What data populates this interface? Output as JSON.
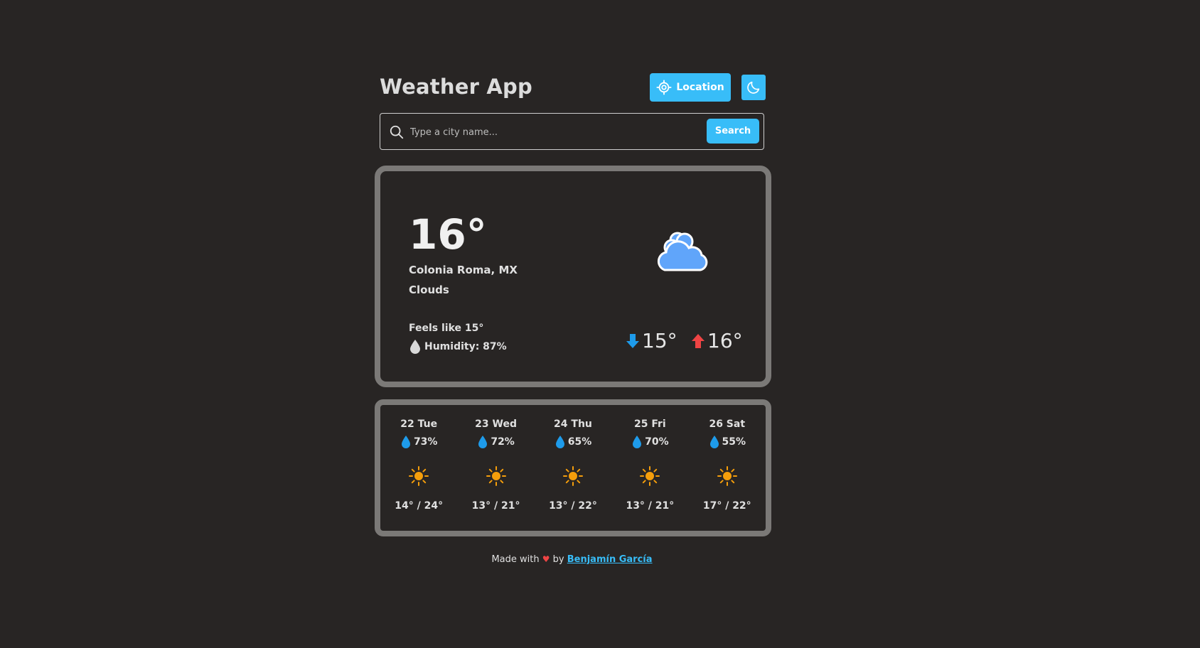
{
  "header": {
    "title": "Weather App",
    "location_button": "Location",
    "location_icon": "crosshair-icon",
    "theme_icon": "moon-icon"
  },
  "search": {
    "placeholder": "Type a city name...",
    "button_label": "Search",
    "icon": "search-icon"
  },
  "current": {
    "temp": "16°",
    "city": "Colonia Roma, MX",
    "description": "Clouds",
    "icon": "cloud-icon",
    "feels_like": "Feels like 15°",
    "humidity": "Humidity: 87%",
    "min_temp": "15°",
    "max_temp": "16°",
    "colors": {
      "min_arrow": "#1e9bea",
      "max_arrow": "#ef4444",
      "cloud": "#60a5fa"
    }
  },
  "forecast": [
    {
      "day": "22 Tue",
      "humidity": "73%",
      "icon": "sun-icon",
      "range": "14° / 24°"
    },
    {
      "day": "23 Wed",
      "humidity": "72%",
      "icon": "sun-icon",
      "range": "13° / 21°"
    },
    {
      "day": "24 Thu",
      "humidity": "65%",
      "icon": "sun-icon",
      "range": "13° / 22°"
    },
    {
      "day": "25 Fri",
      "humidity": "70%",
      "icon": "sun-icon",
      "range": "13° / 21°"
    },
    {
      "day": "26 Sat",
      "humidity": "55%",
      "icon": "sun-icon",
      "range": "17° / 22°"
    }
  ],
  "footer": {
    "made_with": "Made with",
    "by": "by",
    "author": "Benjamín García"
  },
  "colors": {
    "background": "#282524",
    "accent": "#38bdf8",
    "card_border": "#7b7977",
    "sun": "#f59e0b"
  }
}
